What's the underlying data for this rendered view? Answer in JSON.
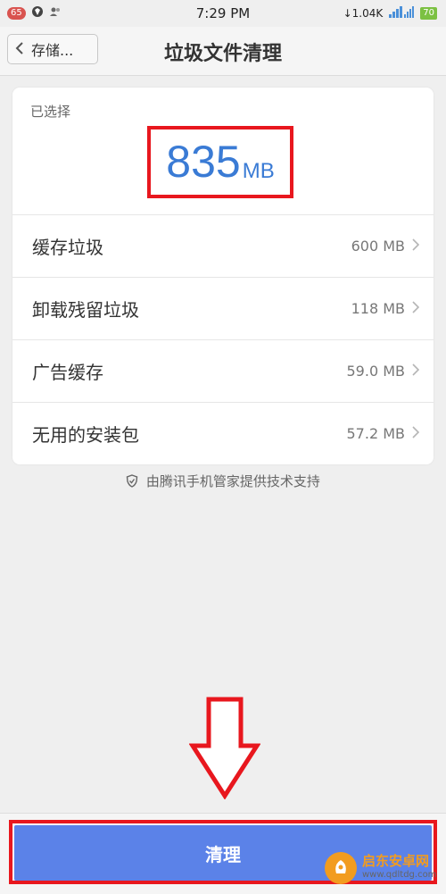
{
  "status_bar": {
    "notif_count": "65",
    "time": "7:29 PM",
    "net_speed": "↓1.04K",
    "battery": "70"
  },
  "header": {
    "back_label": "存储...",
    "title": "垃圾文件清理"
  },
  "summary": {
    "selected_label": "已选择",
    "total_value": "835",
    "total_unit": "MB"
  },
  "items": [
    {
      "label": "缓存垃圾",
      "size": "600 MB"
    },
    {
      "label": "卸载残留垃圾",
      "size": "118 MB"
    },
    {
      "label": "广告缓存",
      "size": "59.0 MB"
    },
    {
      "label": "无用的安装包",
      "size": "57.2 MB"
    }
  ],
  "support_text": "由腾讯手机管家提供技术支持",
  "action": {
    "clean_label": "清理"
  },
  "watermark": {
    "name": "启东安卓网",
    "url": "www.qdltdg.com"
  },
  "colors": {
    "accent_blue": "#3a7bd5",
    "button_blue": "#5b82e8",
    "highlight_red": "#e8171e"
  }
}
